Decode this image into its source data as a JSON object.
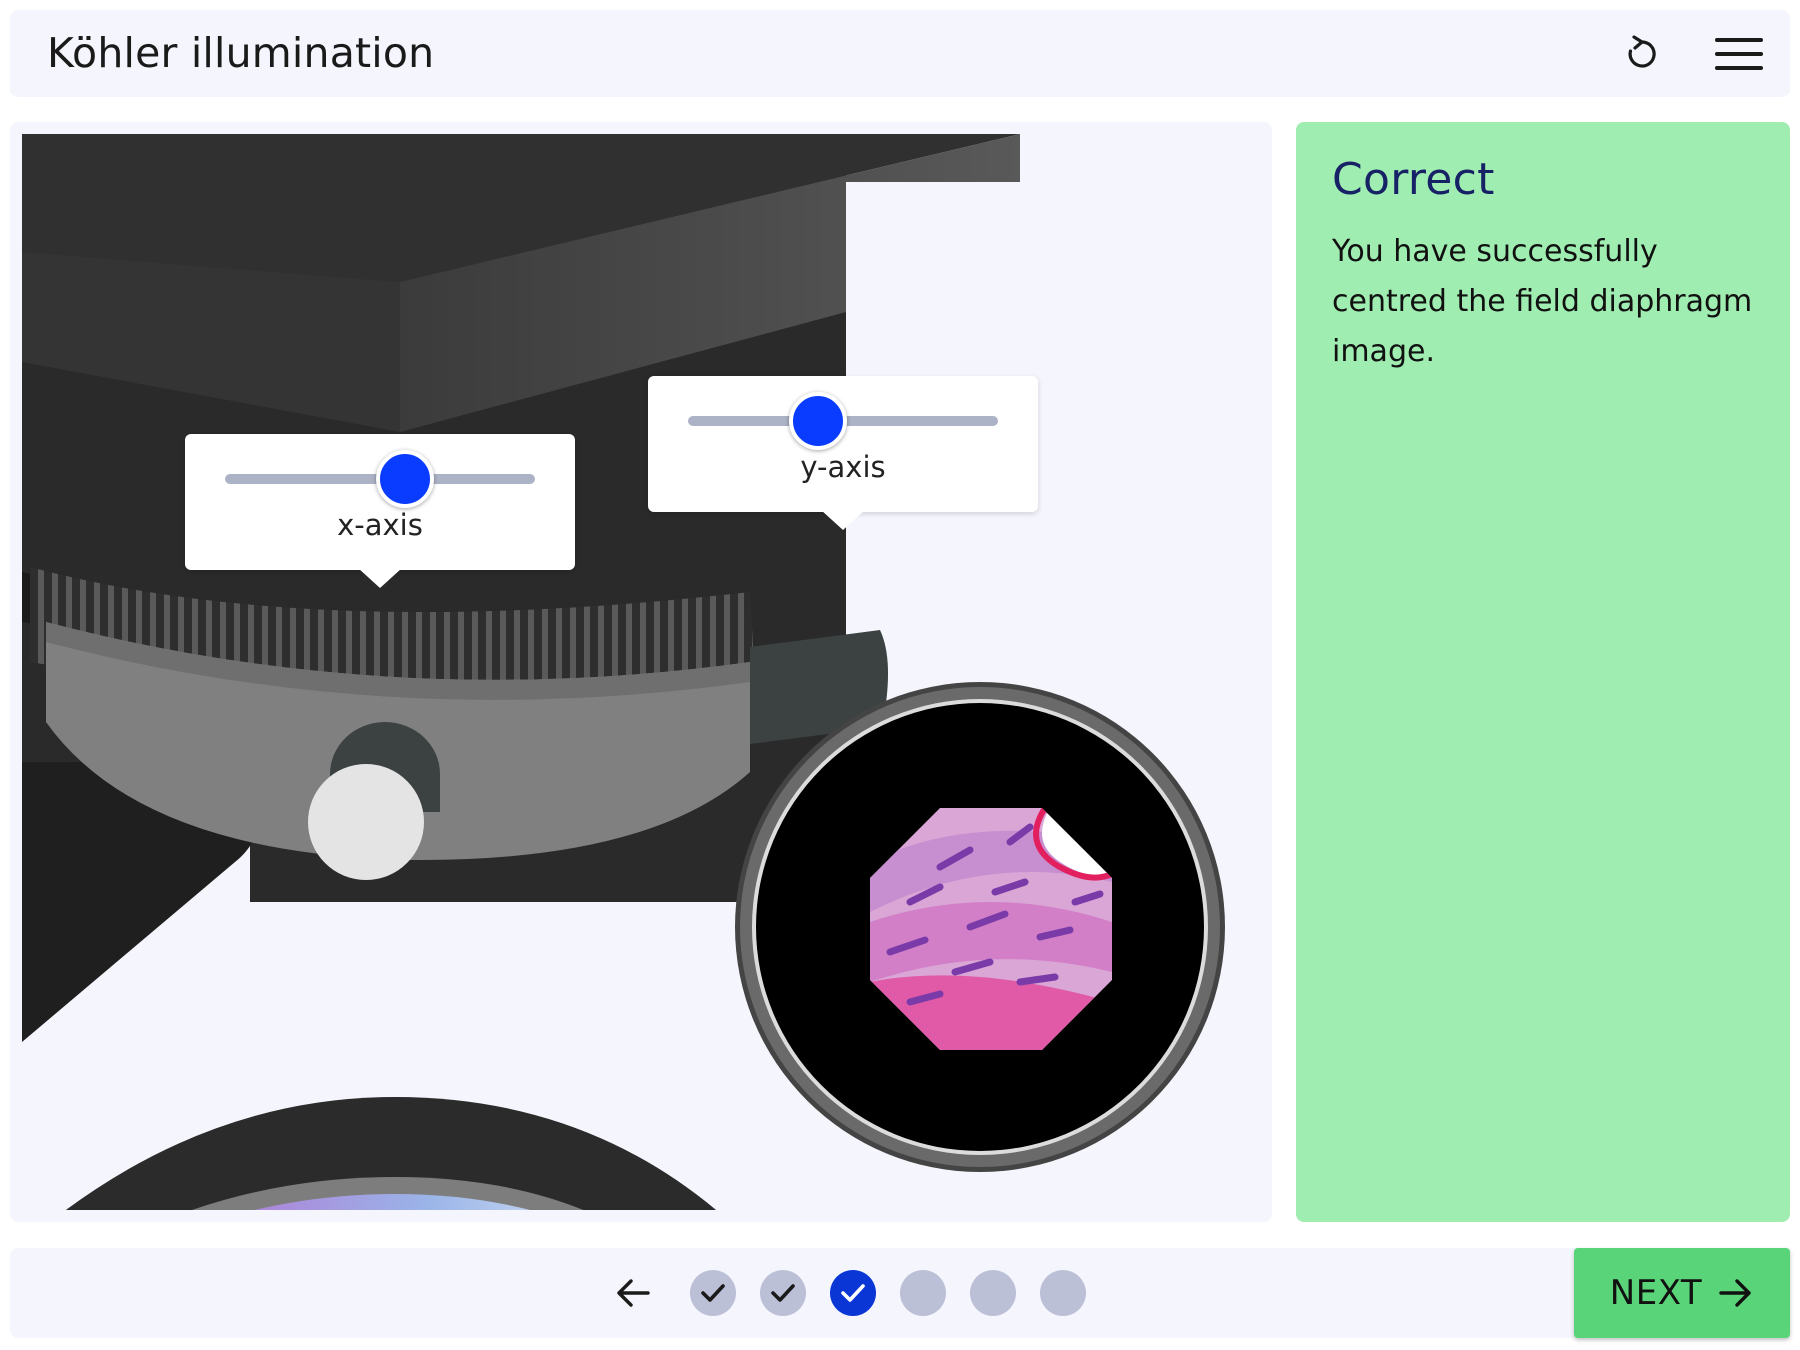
{
  "header": {
    "title": "Köhler illumination",
    "reset_icon": "reset-icon",
    "menu_icon": "menu-icon"
  },
  "stage": {
    "x_slider": {
      "label": "x-axis",
      "value_fraction": 0.58
    },
    "y_slider": {
      "label": "y-axis",
      "value_fraction": 0.42
    }
  },
  "feedback": {
    "title": "Correct",
    "text": "You have successfully centred the field diaphragm image."
  },
  "progress": {
    "back_icon": "arrow-left-icon",
    "steps": [
      {
        "state": "complete"
      },
      {
        "state": "complete"
      },
      {
        "state": "current"
      },
      {
        "state": "pending"
      },
      {
        "state": "pending"
      },
      {
        "state": "pending"
      }
    ]
  },
  "next_button": {
    "label": "NEXT",
    "icon": "arrow-right-icon"
  },
  "colors": {
    "accent_blue": "#0a3cff",
    "success_panel": "#a0edb1",
    "next_green": "#5ad478",
    "panel_bg": "#f5f6fd",
    "title_navy": "#162166"
  }
}
